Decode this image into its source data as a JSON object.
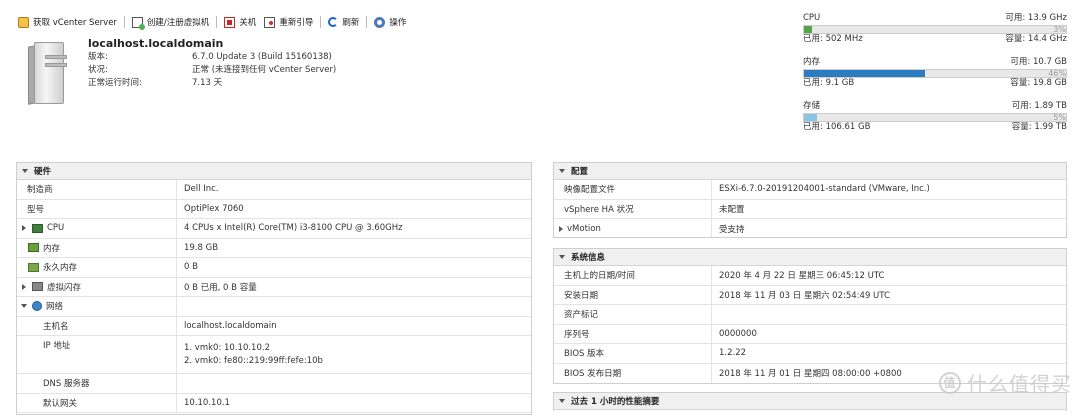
{
  "toolbar": {
    "get_vcenter": "获取 vCenter Server",
    "create_vm": "创建/注册虚拟机",
    "shutdown": "关机",
    "reboot": "重新引导",
    "refresh": "刷新",
    "actions": "操作"
  },
  "host": {
    "name": "localhost.localdomain",
    "fields": [
      {
        "label": "版本:",
        "value": "6.7.0 Update 3 (Build 15160138)"
      },
      {
        "label": "状况:",
        "value": "正常 (未连接到任何 vCenter Server)"
      },
      {
        "label": "正常运行时间:",
        "value": "7.13 天"
      }
    ]
  },
  "resources": {
    "cpu": {
      "name": "CPU",
      "free": "可用: 13.9 GHz",
      "percent_label": "3%",
      "percent": 3,
      "used": "已用: 502 MHz",
      "capacity": "容量: 14.4 GHz",
      "color": "#52a447"
    },
    "memory": {
      "name": "内存",
      "free": "可用: 10.7 GB",
      "percent_label": "46%",
      "percent": 46,
      "used": "已用: 9.1 GB",
      "capacity": "容量: 19.8 GB",
      "color": "#2c7cc2"
    },
    "storage": {
      "name": "存储",
      "free": "可用: 1.89 TB",
      "percent_label": "5%",
      "percent": 5,
      "used": "已用: 106.61 GB",
      "capacity": "容量: 1.99 TB",
      "color": "#89c4e1"
    }
  },
  "hardware": {
    "title": "硬件",
    "rows": [
      {
        "label": "制造商",
        "value": "Dell Inc."
      },
      {
        "label": "型号",
        "value": "OptiPlex 7060"
      },
      {
        "label": "CPU",
        "value": "4 CPUs x Intel(R) Core(TM) i3-8100 CPU @ 3.60GHz"
      },
      {
        "label": "内存",
        "value": "19.8 GB"
      },
      {
        "label": "永久内存",
        "value": "0 B"
      },
      {
        "label": "虚拟闪存",
        "value": "0 B 已用, 0 B 容量"
      },
      {
        "label": "网络",
        "value": ""
      },
      {
        "label": "主机名",
        "value": "localhost.localdomain"
      },
      {
        "label": "IP 地址",
        "value": "1. vmk0: 10.10.10.2",
        "value2": "2. vmk0: fe80::219:99ff:fefe:10b"
      },
      {
        "label": "DNS 服务器",
        "value": ""
      },
      {
        "label": "默认网关",
        "value": "10.10.10.1"
      }
    ]
  },
  "config": {
    "title": "配置",
    "rows": [
      {
        "label": "映像配置文件",
        "value": "ESXi-6.7.0-20191204001-standard (VMware, Inc.)"
      },
      {
        "label": "vSphere HA 状况",
        "value": "未配置"
      },
      {
        "label": "vMotion",
        "value": "受支持"
      }
    ]
  },
  "sysinfo": {
    "title": "系统信息",
    "rows": [
      {
        "label": "主机上的日期/时间",
        "value": "2020 年 4 月 22 日 星期三 06:45:12 UTC"
      },
      {
        "label": "安装日期",
        "value": "2018 年 11 月 03 日 星期六 02:54:49 UTC"
      },
      {
        "label": "资产标记",
        "value": ""
      },
      {
        "label": "序列号",
        "value": "0000000"
      },
      {
        "label": "BIOS 版本",
        "value": "1.2.22"
      },
      {
        "label": "BIOS 发布日期",
        "value": "2018 年 11 月 01 日 星期四 08:00:00 +0800"
      }
    ]
  },
  "perf": {
    "title": "过去 1 小时的性能摘要"
  },
  "watermark": {
    "symbol": "值",
    "text": "什么值得买"
  }
}
